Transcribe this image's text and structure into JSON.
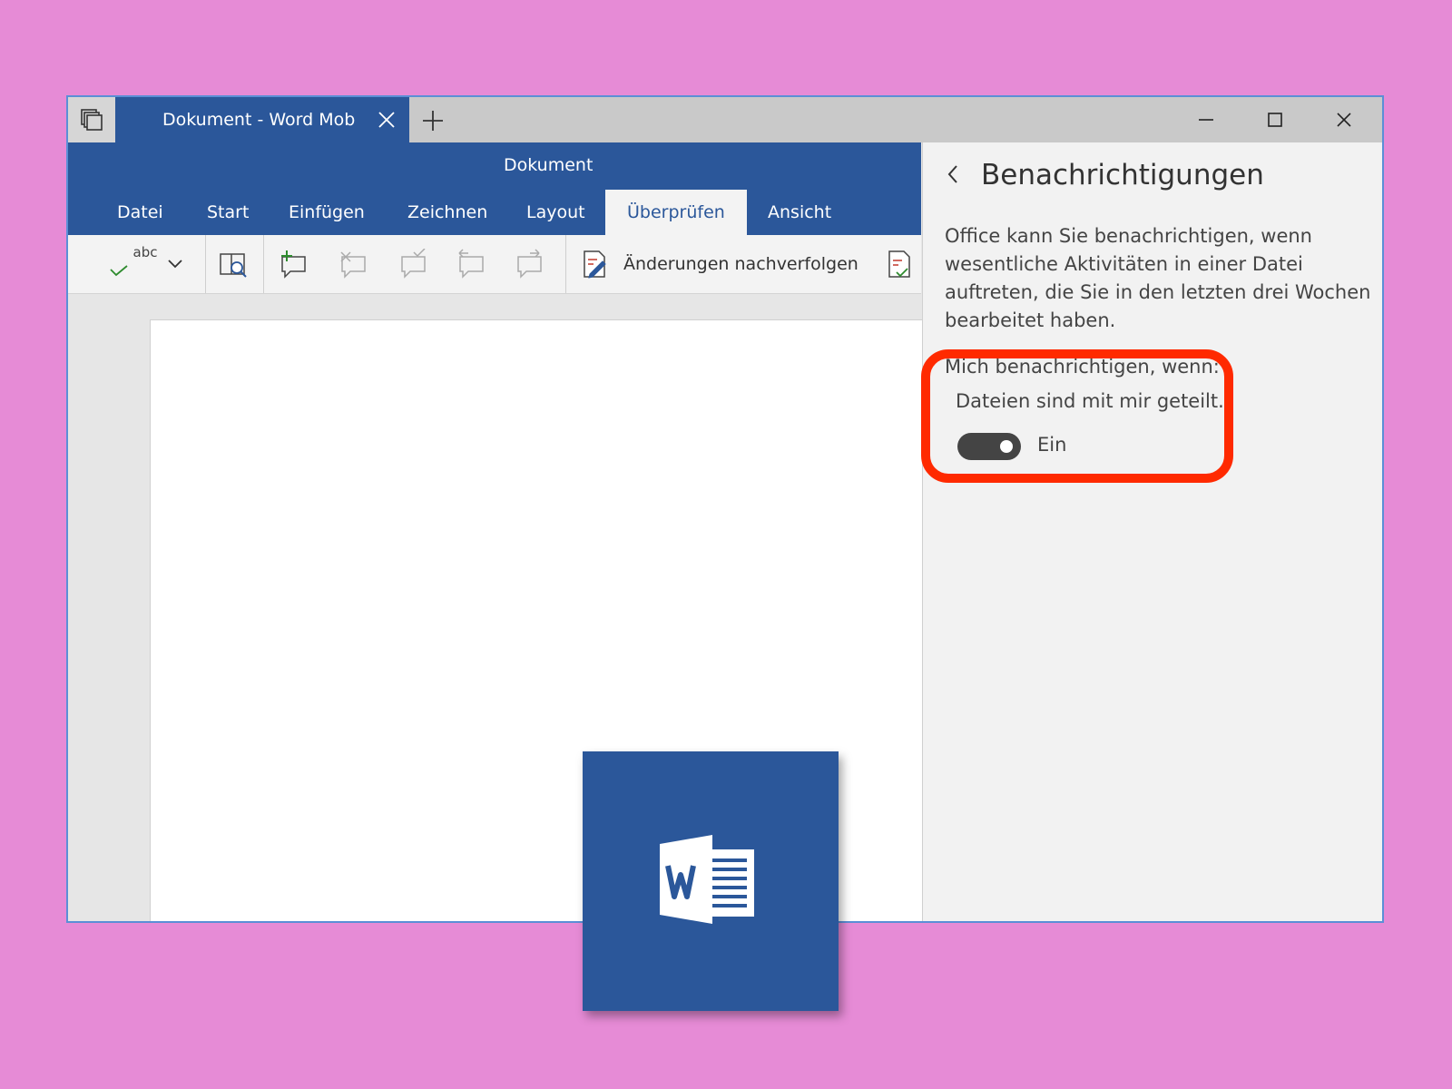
{
  "titlebar": {
    "tab_title": "Dokument - Word Mob",
    "new_tab_symbol": "+"
  },
  "ribbon": {
    "document_title": "Dokument",
    "tabs": [
      {
        "label": "Datei",
        "active": false
      },
      {
        "label": "Start",
        "active": false
      },
      {
        "label": "Einfügen",
        "active": false
      },
      {
        "label": "Zeichnen",
        "active": false
      },
      {
        "label": "Layout",
        "active": false
      },
      {
        "label": "Überprüfen",
        "active": true
      },
      {
        "label": "Ansicht",
        "active": false
      }
    ]
  },
  "toolbar": {
    "spelling_label": "abc",
    "track_changes_label": "Änderungen nachverfolgen"
  },
  "pane": {
    "title": "Benachrichtigungen",
    "description": "Office kann Sie benachrichtigen, wenn wesentliche Aktivitäten in einer Datei auftreten, die Sie in den letzten drei Wochen bearbeitet haben.",
    "notify_label": "Mich benachrichtigen, wenn:",
    "option_label": "Dateien sind mit mir geteilt.",
    "toggle_state": "Ein",
    "toggle_on": true
  },
  "colors": {
    "background": "#e68bd6",
    "word_blue": "#2b579a",
    "highlight": "#ff2a00"
  },
  "icons": [
    "window-switcher-icon",
    "close-icon",
    "plus-icon",
    "minimize-icon",
    "maximize-icon",
    "spelling-icon",
    "chevron-down-icon",
    "smart-lookup-icon",
    "new-comment-icon",
    "delete-comment-icon",
    "resolve-comment-icon",
    "previous-comment-icon",
    "next-comment-icon",
    "track-changes-icon",
    "back-arrow-icon",
    "word-logo-icon"
  ]
}
